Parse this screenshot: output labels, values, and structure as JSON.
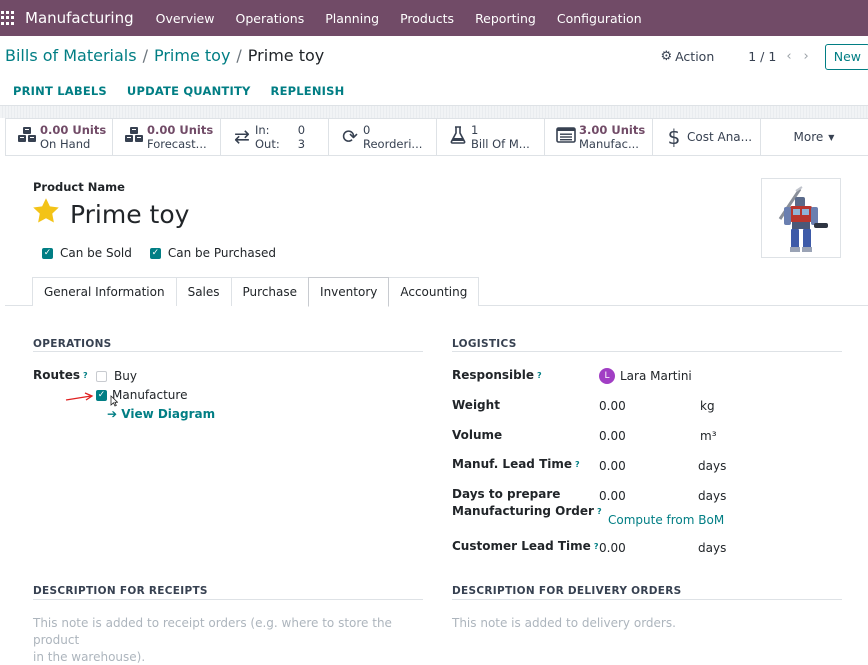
{
  "navbar": {
    "app": "Manufacturing",
    "menu": [
      "Overview",
      "Operations",
      "Planning",
      "Products",
      "Reporting",
      "Configuration"
    ]
  },
  "breadcrumb": {
    "parent1": "Bills of Materials",
    "parent2": "Prime toy",
    "current": "Prime toy"
  },
  "control": {
    "action": "Action",
    "pager": "1 / 1",
    "new": "New"
  },
  "header_buttons": [
    "PRINT LABELS",
    "UPDATE QUANTITY",
    "REPLENISH"
  ],
  "smart_buttons": {
    "on_hand": {
      "value": "0.00 Units",
      "label": "On Hand",
      "icon": "cubes-icon"
    },
    "forecast": {
      "value": "0.00 Units",
      "label": "Forecast...",
      "icon": "cubes-icon"
    },
    "in_out": {
      "in_label": "In:",
      "in_value": "0",
      "out_label": "Out:",
      "out_value": "3",
      "icon": "exchange-icon"
    },
    "reordering": {
      "value": "0",
      "label": "Reorderi...",
      "icon": "refresh-icon"
    },
    "bom": {
      "value": "1",
      "label": "Bill Of M...",
      "icon": "flask-icon"
    },
    "manufactured": {
      "value": "3.00 Units",
      "label": "Manufac...",
      "icon": "list-icon"
    },
    "cost": {
      "label": "Cost Ana...",
      "icon": "dollar-icon"
    },
    "more": "More"
  },
  "product": {
    "name_label": "Product Name",
    "name": "Prime toy",
    "can_be_sold": "Can be Sold",
    "can_be_purchased": "Can be Purchased"
  },
  "tabs": [
    "General Information",
    "Sales",
    "Purchase",
    "Inventory",
    "Accounting"
  ],
  "operations": {
    "title": "OPERATIONS",
    "routes_label": "Routes",
    "help": "?",
    "route_buy": "Buy",
    "route_manufacture": "Manufacture",
    "view_diagram": "View Diagram"
  },
  "logistics": {
    "title": "LOGISTICS",
    "responsible_label": "Responsible",
    "responsible_initial": "L",
    "responsible": "Lara Martini",
    "weight_label": "Weight",
    "weight": "0.00",
    "weight_unit": "kg",
    "volume_label": "Volume",
    "volume": "0.00",
    "volume_unit": "m³",
    "lead_label": "Manuf. Lead Time",
    "lead": "0.00",
    "lead_unit": "days",
    "prep_label1": "Days to prepare",
    "prep_label2": "Manufacturing Order",
    "prep": "0.00",
    "prep_unit": "days",
    "compute": "Compute from BoM",
    "customer_label": "Customer Lead Time",
    "customer": "0.00",
    "customer_unit": "days"
  },
  "descriptions": {
    "receipts_title": "DESCRIPTION FOR RECEIPTS",
    "receipts_placeholder1": "This note is added to receipt orders (e.g. where to store the product",
    "receipts_placeholder2": "in the warehouse).",
    "delivery_title": "DESCRIPTION FOR DELIVERY ORDERS",
    "delivery_placeholder": "This note is added to delivery orders."
  },
  "colors": {
    "brand": "#714b67",
    "accent": "#017e84",
    "annotation": "#e02020"
  }
}
